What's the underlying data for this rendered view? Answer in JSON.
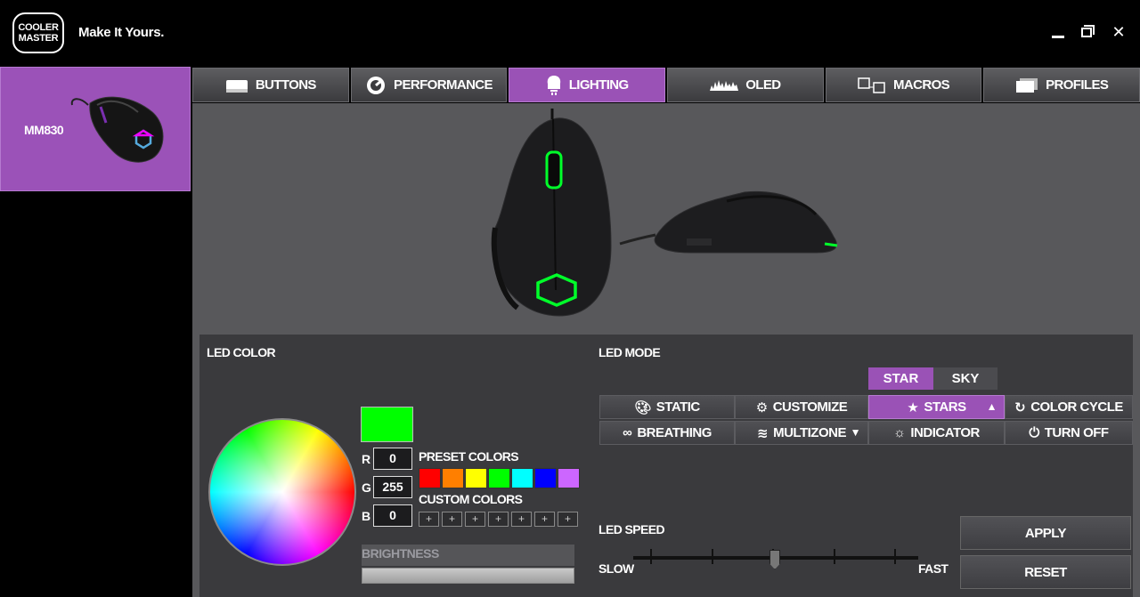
{
  "window": {
    "logo_lines": [
      "COOLER",
      "MASTER"
    ],
    "tagline": "Make It Yours.",
    "minimize_glyph": "",
    "close_glyph": "✕"
  },
  "sidebar": {
    "device_name": "MM830"
  },
  "tabs": [
    {
      "label": "BUTTONS",
      "icon": "keyboard-icon",
      "active": false
    },
    {
      "label": "PERFORMANCE",
      "icon": "gauge-icon",
      "active": false
    },
    {
      "label": "LIGHTING",
      "icon": "bulb-icon",
      "active": true
    },
    {
      "label": "OLED",
      "icon": "waveform-icon",
      "active": false
    },
    {
      "label": "MACROS",
      "icon": "macro-icon",
      "active": false
    },
    {
      "label": "PROFILES",
      "icon": "profiles-icon",
      "active": false
    }
  ],
  "led_color": {
    "title": "LED COLOR",
    "current_color": "#00ff00",
    "r_label": "R",
    "r_value": "0",
    "g_label": "G",
    "g_value": "255",
    "b_label": "B",
    "b_value": "0",
    "preset_title": "PRESET COLORS",
    "presets": [
      "#ff0000",
      "#ff7f00",
      "#ffff00",
      "#00ff00",
      "#00ffff",
      "#0000ff",
      "#cc66ff"
    ],
    "custom_title": "CUSTOM COLORS",
    "custom_slot_glyph": "+",
    "custom_slot_count": 7,
    "brightness_label": "BRIGHTNESS",
    "brightness_level": 1.0
  },
  "led_mode": {
    "title": "LED MODE",
    "sub_options": [
      {
        "label": "STAR",
        "active": true
      },
      {
        "label": "SKY",
        "active": false
      }
    ],
    "modes": {
      "static": "STATIC",
      "customize": "CUSTOMIZE",
      "stars": "STARS",
      "color_cycle": "COLOR CYCLE",
      "breathing": "BREATHING",
      "multizone": "MULTIZONE",
      "indicator": "INDICATOR",
      "turn_off": "TURN OFF"
    },
    "active_mode": "stars",
    "stars_arrow": "▲",
    "multizone_arrow": "▼"
  },
  "led_speed": {
    "title": "LED SPEED",
    "slow_label": "SLOW",
    "fast_label": "FAST",
    "level": 3,
    "max_level": 5
  },
  "actions": {
    "apply": "APPLY",
    "reset": "RESET"
  },
  "colors": {
    "accent": "#9a52b6",
    "panel_bg": "#3a3a3d",
    "preview_bg": "#58585b",
    "mouse_led": "#00ff2a"
  }
}
